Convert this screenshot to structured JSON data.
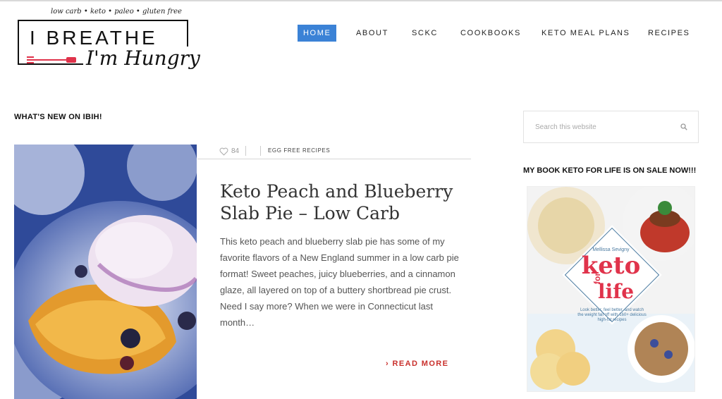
{
  "site": {
    "tagline": "low carb • keto • paleo • gluten free",
    "logo_title": "I BREATHE",
    "logo_script": "I'm Hungry"
  },
  "nav": {
    "items": [
      {
        "label": "HOME",
        "active": true
      },
      {
        "label": "ABOUT"
      },
      {
        "label": "SCKC"
      },
      {
        "label": "COOKBOOKS"
      },
      {
        "label": "KETO MEAL PLANS"
      },
      {
        "label": "RECIPES"
      }
    ]
  },
  "main": {
    "section_heading": "WHAT'S NEW ON IBIH!",
    "post": {
      "likes": "84",
      "category": "EGG FREE RECIPES",
      "title": "Keto Peach and Blueberry Slab Pie – Low Carb",
      "excerpt": "This keto peach and blueberry slab pie has some of my favorite flavors of a New England summer in a low carb pie format!  Sweet peaches, juicy blueberries, and a cinnamon glaze, all layered on top of a buttery shortbread pie crust.  Need I say more?    When we were in Connecticut last month…",
      "read_more": "READ MORE"
    }
  },
  "sidebar": {
    "search": {
      "placeholder": "Search this website"
    },
    "book_heading": "MY BOOK KETO FOR LIFE IS ON SALE NOW!!!",
    "book": {
      "author": "Mellissa Sevigny",
      "title_top": "keto",
      "title_for": "for",
      "title_bottom": "life",
      "subtitle": "Look better, feel better, and watch the weight fall off with 160+ delicious high-fat recipes"
    }
  },
  "colors": {
    "accent": "#3b82d6",
    "read_more": "#c9302c",
    "logo_red": "#e0334b"
  }
}
